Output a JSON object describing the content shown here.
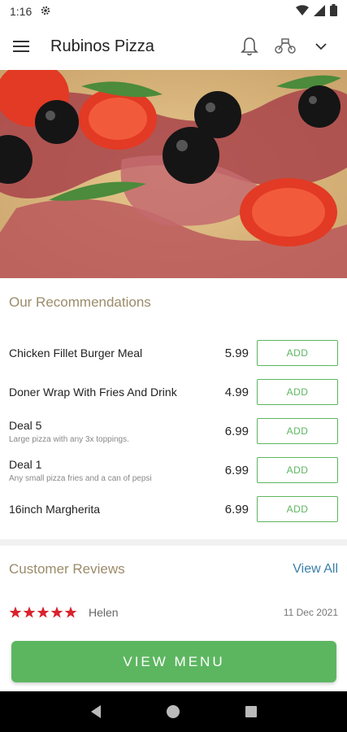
{
  "status_bar": {
    "time": "1:16"
  },
  "app_bar": {
    "title": "Rubinos Pizza"
  },
  "recommendations": {
    "title": "Our Recommendations",
    "add_label": "ADD",
    "items": [
      {
        "name": "Chicken Fillet Burger Meal",
        "desc": "",
        "price": "5.99"
      },
      {
        "name": "Doner Wrap With Fries And Drink",
        "desc": "",
        "price": "4.99"
      },
      {
        "name": "Deal 5",
        "desc": "Large pizza with any 3x toppings.",
        "price": "6.99"
      },
      {
        "name": "Deal 1",
        "desc": "Any small pizza fries and a can of pepsi",
        "price": "6.99"
      },
      {
        "name": "16inch Margherita",
        "desc": "",
        "price": "6.99"
      }
    ]
  },
  "reviews": {
    "title": "Customer Reviews",
    "view_all": "View All",
    "items": [
      {
        "rating": 5,
        "name": "Helen",
        "date": "11 Dec 2021"
      }
    ]
  },
  "view_menu": "VIEW MENU",
  "colors": {
    "accent_green": "#5cb660",
    "section_title": "#9b8b6a",
    "link_blue": "#3a7fa8",
    "star_red": "#d9232d"
  },
  "icons": [
    "settings-icon",
    "wifi-icon",
    "signal-icon",
    "battery-icon",
    "hamburger-menu-icon",
    "bell-icon",
    "delivery-scooter-icon",
    "chevron-down-icon",
    "star-icon",
    "back-icon",
    "home-icon",
    "recents-icon"
  ]
}
